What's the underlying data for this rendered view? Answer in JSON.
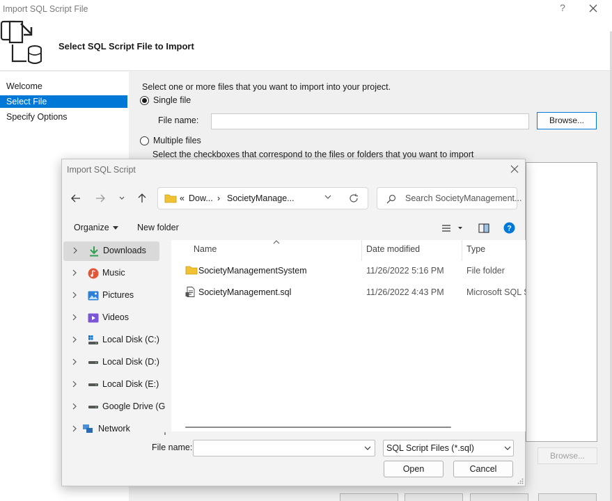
{
  "wizard": {
    "title": "Import SQL Script File",
    "help_glyph": "?",
    "header_text": "Select SQL Script File to Import",
    "nav": [
      {
        "label": "Welcome",
        "selected": false
      },
      {
        "label": "Select File",
        "selected": true
      },
      {
        "label": "Specify Options",
        "selected": false
      }
    ],
    "intro": "Select one or more files that you want to import into your project.",
    "single_file_label": "Single file",
    "file_name_label": "File name:",
    "browse_label": "Browse...",
    "multiple_files_label": "Multiple files",
    "multiple_files_hint": "Select the checkboxes that correspond to the files or folders that you want to import",
    "browse2_label": "Browse...",
    "accent": "#0078d7"
  },
  "dialog": {
    "title": "Import SQL Script",
    "address": {
      "overflow": "«",
      "crumb1": "Dow...",
      "separator": "›",
      "crumb2": "SocietyManage..."
    },
    "search_placeholder": "Search SocietyManagement...",
    "organize_label": "Organize",
    "new_folder_label": "New folder",
    "nav_tree": [
      {
        "label": "Downloads",
        "icon": "download-arrow-icon",
        "selected": true
      },
      {
        "label": "Music",
        "icon": "music-icon",
        "selected": false
      },
      {
        "label": "Pictures",
        "icon": "pictures-icon",
        "selected": false
      },
      {
        "label": "Videos",
        "icon": "videos-icon",
        "selected": false
      },
      {
        "label": "Local Disk (C:)",
        "icon": "windows-drive-icon",
        "selected": false
      },
      {
        "label": "Local Disk (D:)",
        "icon": "drive-icon",
        "selected": false
      },
      {
        "label": "Local Disk (E:)",
        "icon": "drive-icon",
        "selected": false
      },
      {
        "label": "Google Drive (G:)",
        "icon": "drive-icon",
        "selected": false
      },
      {
        "label": "Network",
        "icon": "network-icon",
        "selected": false
      }
    ],
    "columns": {
      "name": "Name",
      "date": "Date modified",
      "type": "Type"
    },
    "files": [
      {
        "name": "SocietyManagementSystem",
        "date": "11/26/2022 5:16 PM",
        "type": "File folder",
        "icon": "folder-icon"
      },
      {
        "name": "SocietyManagement.sql",
        "date": "11/26/2022 4:43 PM",
        "type": "Microsoft SQL Server Query File",
        "icon": "sql-file-icon"
      }
    ],
    "file_name_label": "File name:",
    "file_name_value": "",
    "file_type": "SQL Script Files (*.sql)",
    "open_label": "Open",
    "cancel_label": "Cancel",
    "colors": {
      "folder": "#f1c232",
      "download": "#2e9e4f",
      "music": "#e0583a",
      "pictures": "#2b7fd4",
      "videos": "#7b54d8",
      "help": "#0078d7"
    }
  }
}
